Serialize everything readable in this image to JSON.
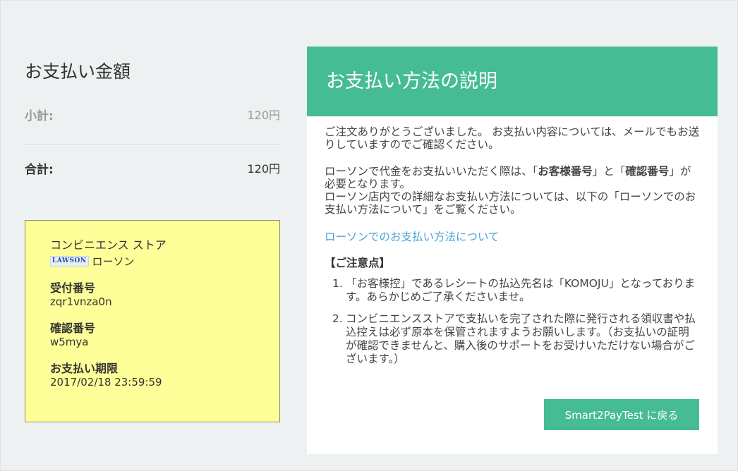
{
  "summary": {
    "title": "お支払い金額",
    "subtotal_label": "小計:",
    "subtotal_value": "120円",
    "total_label": "合計:",
    "total_value": "120円"
  },
  "receipt": {
    "store_type": "コンビニエンス ストア",
    "store_logo_text": "LAWSON",
    "store_name": "ローソン",
    "reception_label": "受付番号",
    "reception_value": "zqr1vnza0n",
    "confirmation_label": "確認番号",
    "confirmation_value": "w5mya",
    "deadline_label": "お支払い期限",
    "deadline_value": "2017/02/18 23:59:59"
  },
  "panel": {
    "title": "お支払い方法の説明",
    "thanks": "ご注文ありがとうございました。 お支払い内容については、メールでもお送りしていますのでご確認ください。",
    "lawson_p1_a": "ローソンで代金をお支払いいただく際は、「",
    "lawson_p1_b": "お客様番号",
    "lawson_p1_c": "」と「",
    "lawson_p1_d": "確認番号",
    "lawson_p1_e": "」が必要となります。",
    "lawson_p2": "ローソン店内での詳細なお支払い方法については、以下の「ローソンでのお支払い方法について」をご覧ください。",
    "link_label": "ローソンでのお支払い方法について",
    "notes_heading": "【ご注意点】",
    "notes": [
      {
        "num": "1.",
        "text": "「お客様控」であるレシートの払込先名は「KOMOJU」となっております。あらかじめご了承くださいませ。"
      },
      {
        "num": "2.",
        "text": "コンビニエンスストアで支払いを完了された際に発行される領収書や払込控えは必ず原本を保管されますようお願いします。（お支払いの証明が確認できませんと、購入後のサポートをお受けいただけない場合がございます。）"
      }
    ],
    "back_button": "Smart2PayTest に戻る"
  },
  "colors": {
    "accent": "#46bc94",
    "link": "#4aa3d6",
    "receipt_bg": "#ffff99",
    "page_bg": "#eef1f2"
  }
}
